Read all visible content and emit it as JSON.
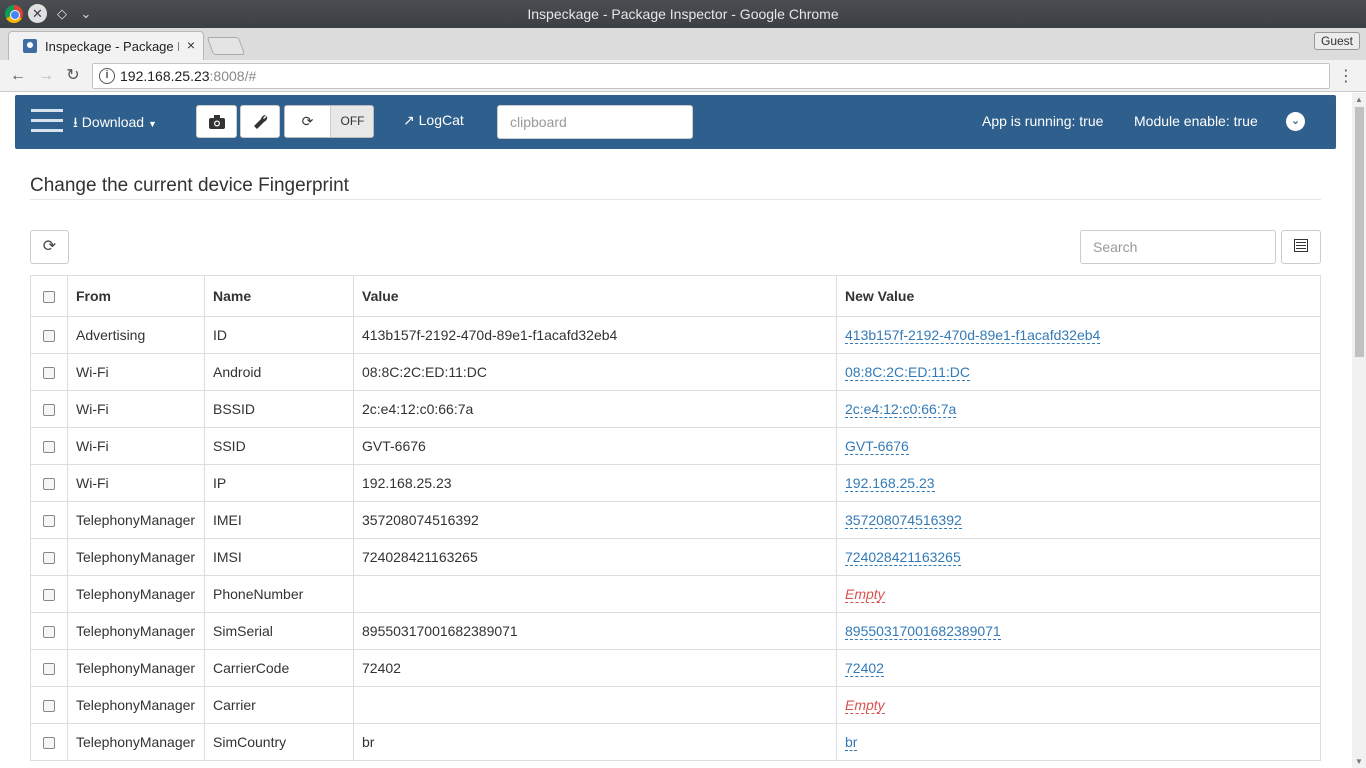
{
  "window": {
    "title": "Inspeckage - Package Inspector - Google Chrome"
  },
  "tab": {
    "title": "Inspeckage - Package Inspector",
    "close": "×"
  },
  "profile": {
    "label": "Guest"
  },
  "address": {
    "host": "192.168.25.23",
    "rest": ":8008/#"
  },
  "navbar": {
    "download_label": "Download",
    "logcat_label": "LogCat",
    "toggle_state": "OFF",
    "clipboard_placeholder": "clipboard",
    "app_status": "App is running: true",
    "module_status": "Module enable: true"
  },
  "page": {
    "heading": "Change the current device Fingerprint",
    "search_placeholder": "Search"
  },
  "table": {
    "headers": {
      "from": "From",
      "name": "Name",
      "value": "Value",
      "new_value": "New Value"
    },
    "rows": [
      {
        "from": "Advertising",
        "name": "ID",
        "value": "413b157f-2192-470d-89e1-f1acafd32eb4",
        "new_value": "413b157f-2192-470d-89e1-f1acafd32eb4"
      },
      {
        "from": "Wi-Fi",
        "name": "Android",
        "value": "08:8C:2C:ED:11:DC",
        "new_value": "08:8C:2C:ED:11:DC"
      },
      {
        "from": "Wi-Fi",
        "name": "BSSID",
        "value": "2c:e4:12:c0:66:7a",
        "new_value": "2c:e4:12:c0:66:7a"
      },
      {
        "from": "Wi-Fi",
        "name": "SSID",
        "value": "GVT-6676",
        "new_value": "GVT-6676"
      },
      {
        "from": "Wi-Fi",
        "name": "IP",
        "value": "192.168.25.23",
        "new_value": "192.168.25.23"
      },
      {
        "from": "TelephonyManager",
        "name": "IMEI",
        "value": "357208074516392",
        "new_value": "357208074516392"
      },
      {
        "from": "TelephonyManager",
        "name": "IMSI",
        "value": "724028421163265",
        "new_value": "724028421163265"
      },
      {
        "from": "TelephonyManager",
        "name": "PhoneNumber",
        "value": "",
        "new_value": "Empty"
      },
      {
        "from": "TelephonyManager",
        "name": "SimSerial",
        "value": "89550317001682389071",
        "new_value": "89550317001682389071"
      },
      {
        "from": "TelephonyManager",
        "name": "CarrierCode",
        "value": "72402",
        "new_value": "72402"
      },
      {
        "from": "TelephonyManager",
        "name": "Carrier",
        "value": "",
        "new_value": "Empty"
      },
      {
        "from": "TelephonyManager",
        "name": "SimCountry",
        "value": "br",
        "new_value": "br"
      }
    ]
  },
  "colors": {
    "navbar": "#2f5f8c",
    "link": "#337ab7",
    "empty": "#d9534f"
  }
}
